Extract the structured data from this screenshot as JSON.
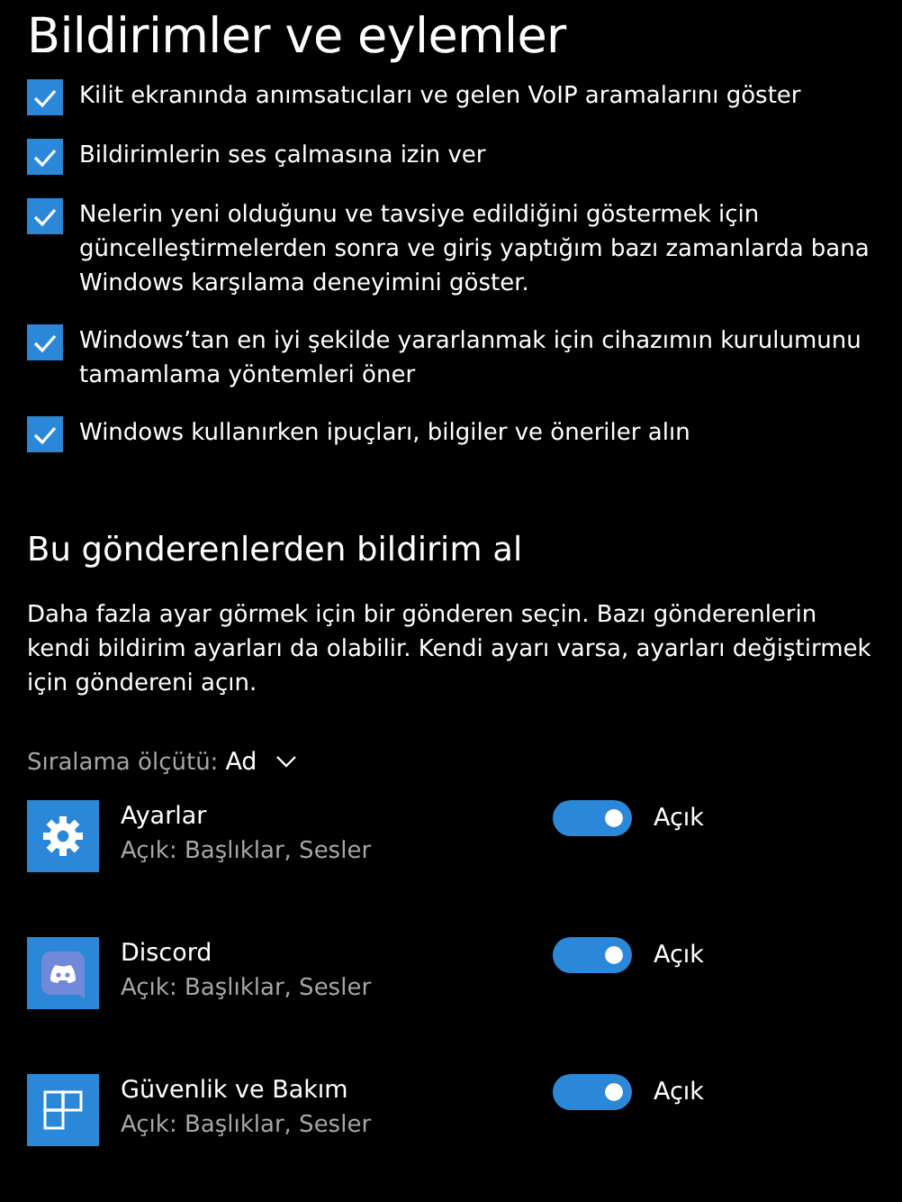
{
  "title": "Bildirimler ve eylemler",
  "options": [
    {
      "label": "Kilit ekranında anımsatıcıları ve gelen VoIP aramalarını göster",
      "checked": true
    },
    {
      "label": "Bildirimlerin ses çalmasına izin ver",
      "checked": true
    },
    {
      "label": "Nelerin yeni olduğunu ve tavsiye edildiğini göstermek için güncelleştirmelerden sonra ve giriş yaptığım bazı zamanlarda bana Windows karşılama deneyimini göster.",
      "checked": true
    },
    {
      "label": "Windows’tan en iyi şekilde yararlanmak için cihazımın kurulumunu tamamlama yöntemleri öner",
      "checked": true
    },
    {
      "label": "Windows kullanırken ipuçları, bilgiler ve öneriler alın",
      "checked": true
    }
  ],
  "senders_heading": "Bu gönderenlerden bildirim al",
  "senders_description": "Daha fazla ayar görmek için bir gönderen seçin. Bazı gönderenlerin kendi bildirim ayarları da olabilir. Kendi ayarı varsa, ayarları değiştirmek için göndereni açın.",
  "sort": {
    "label": "Sıralama ölçütü:",
    "value": "Ad"
  },
  "apps": [
    {
      "name": "Ayarlar",
      "detail": "Açık: Başlıklar, Sesler",
      "kind": "settings",
      "on": true,
      "state": "Açık"
    },
    {
      "name": "Discord",
      "detail": "Açık: Başlıklar, Sesler",
      "kind": "discord",
      "on": true,
      "state": "Açık"
    },
    {
      "name": "Güvenlik ve Bakım",
      "detail": "Açık: Başlıklar, Sesler",
      "kind": "security",
      "on": true,
      "state": "Açık"
    }
  ]
}
